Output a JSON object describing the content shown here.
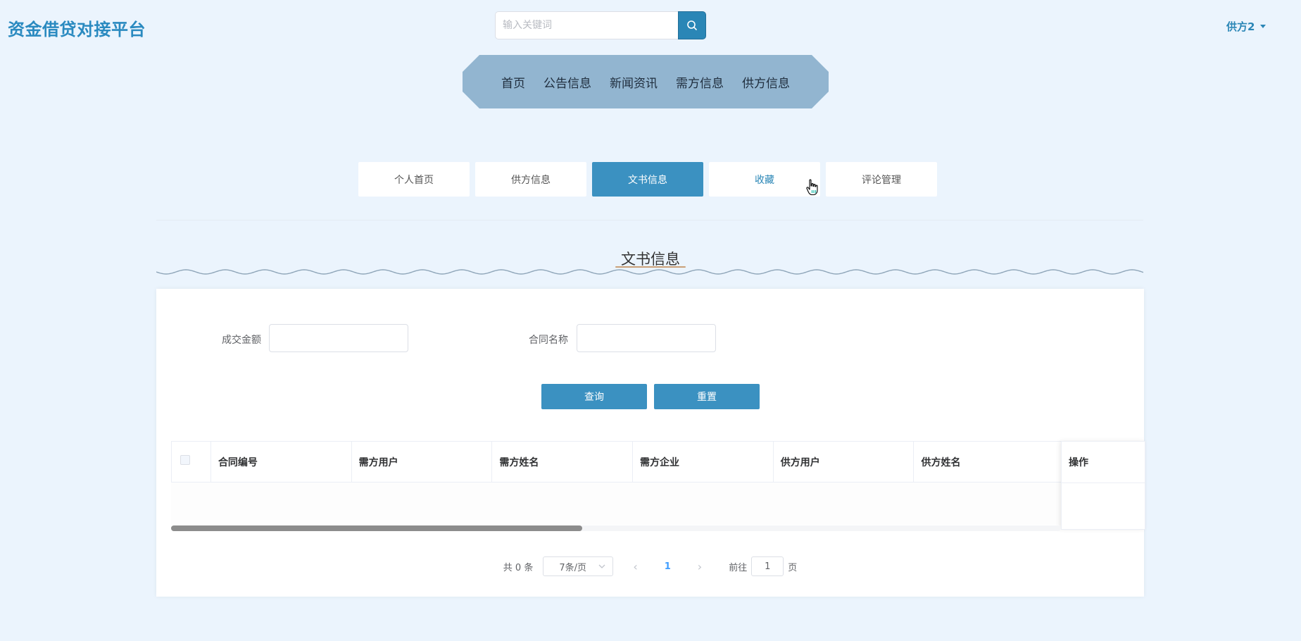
{
  "header": {
    "logo": "资金借贷对接平台",
    "search_placeholder": "输入关键词",
    "user_name": "供方2"
  },
  "main_nav": [
    {
      "label": "首页"
    },
    {
      "label": "公告信息"
    },
    {
      "label": "新闻资讯"
    },
    {
      "label": "需方信息"
    },
    {
      "label": "供方信息"
    }
  ],
  "sub_tabs": [
    {
      "label": "个人首页",
      "state": "normal"
    },
    {
      "label": "供方信息",
      "state": "normal"
    },
    {
      "label": "文书信息",
      "state": "active"
    },
    {
      "label": "收藏",
      "state": "hover"
    },
    {
      "label": "评论管理",
      "state": "normal"
    }
  ],
  "section": {
    "title": "文书信息"
  },
  "filters": {
    "amount_label": "成交金额",
    "amount_value": "",
    "contract_label": "合同名称",
    "contract_value": ""
  },
  "buttons": {
    "query": "查询",
    "reset": "重置"
  },
  "table": {
    "columns": [
      "合同编号",
      "需方用户",
      "需方姓名",
      "需方企业",
      "供方用户",
      "供方姓名"
    ],
    "ops_column": "操作",
    "rows": []
  },
  "pagination": {
    "total_text": "共 0 条",
    "page_size": "7条/页",
    "current_page": "1",
    "goto_prefix": "前往",
    "goto_value": "1",
    "goto_suffix": "页"
  },
  "colors": {
    "brand": "#2a8ac0",
    "nav_bg": "#92b5d0",
    "active_tab": "#3b91c1",
    "page_bg": "#ebf4fd"
  }
}
